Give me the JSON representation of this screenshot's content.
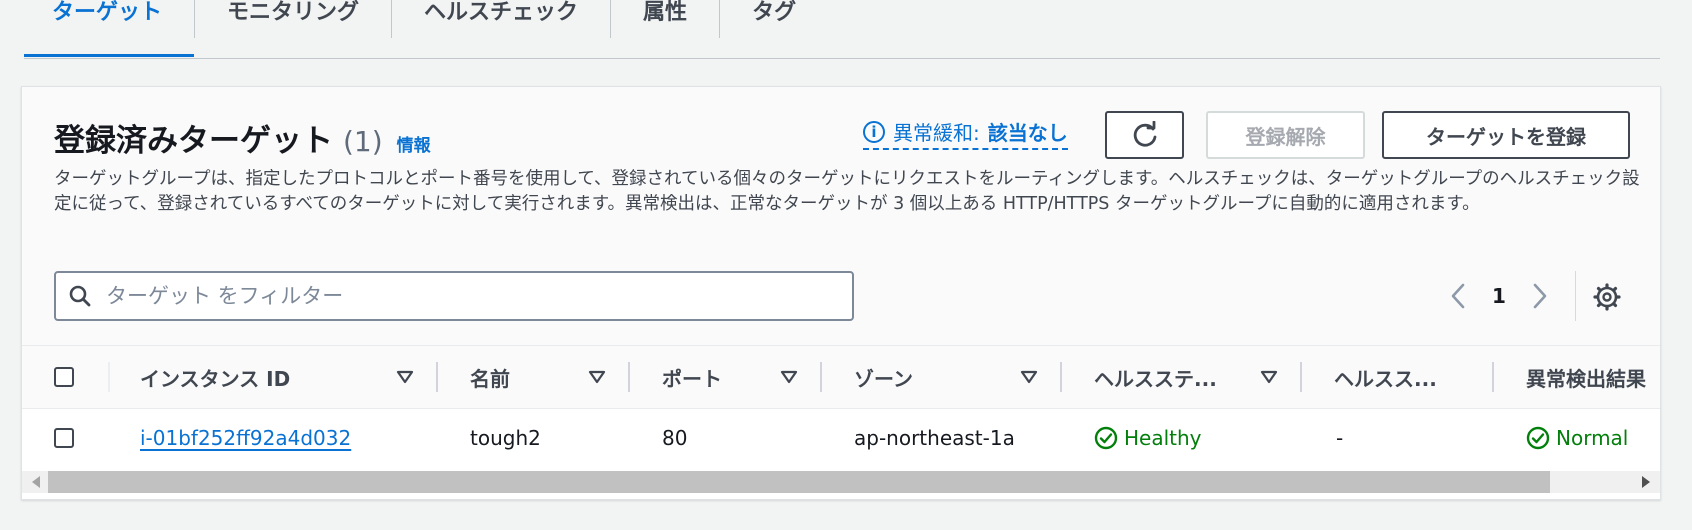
{
  "tabs": [
    {
      "label": "ターゲット",
      "active": true
    },
    {
      "label": "モニタリング",
      "active": false
    },
    {
      "label": "ヘルスチェック",
      "active": false
    },
    {
      "label": "属性",
      "active": false
    },
    {
      "label": "タグ",
      "active": false
    }
  ],
  "panel": {
    "title": "登録済みターゲット",
    "count": "(1)",
    "info_link": "情報",
    "anomaly_label": "異常緩和:",
    "anomaly_value": "該当なし",
    "deregister_label": "登録解除",
    "register_label": "ターゲットを登録",
    "description": "ターゲットグループは、指定したプロトコルとポート番号を使用して、登録されている個々のターゲットにリクエストをルーティングします。ヘルスチェックは、ターゲットグループのヘルスチェック設定に従って、登録されているすべてのターゲットに対して実行されます。異常検出は、正常なターゲットが 3 個以上ある HTTP/HTTPS ターゲットグループに自動的に適用されます。"
  },
  "search": {
    "placeholder": "ターゲット をフィルター",
    "value": ""
  },
  "pagination": {
    "current_page": "1"
  },
  "table": {
    "columns": [
      "インスタンス ID",
      "名前",
      "ポート",
      "ゾーン",
      "ヘルスステ...",
      "ヘルスス...",
      "異常検出結果"
    ],
    "rows": [
      {
        "instance_id": "i-01bf252ff92a4d032",
        "name": "tough2",
        "port": "80",
        "zone": "ap-northeast-1a",
        "health_status": "Healthy",
        "health_details": "-",
        "anomaly_result": "Normal"
      }
    ]
  },
  "colors": {
    "accent": "#0972d3",
    "success": "#037f0c",
    "text": "#16191f",
    "muted": "#414750"
  }
}
